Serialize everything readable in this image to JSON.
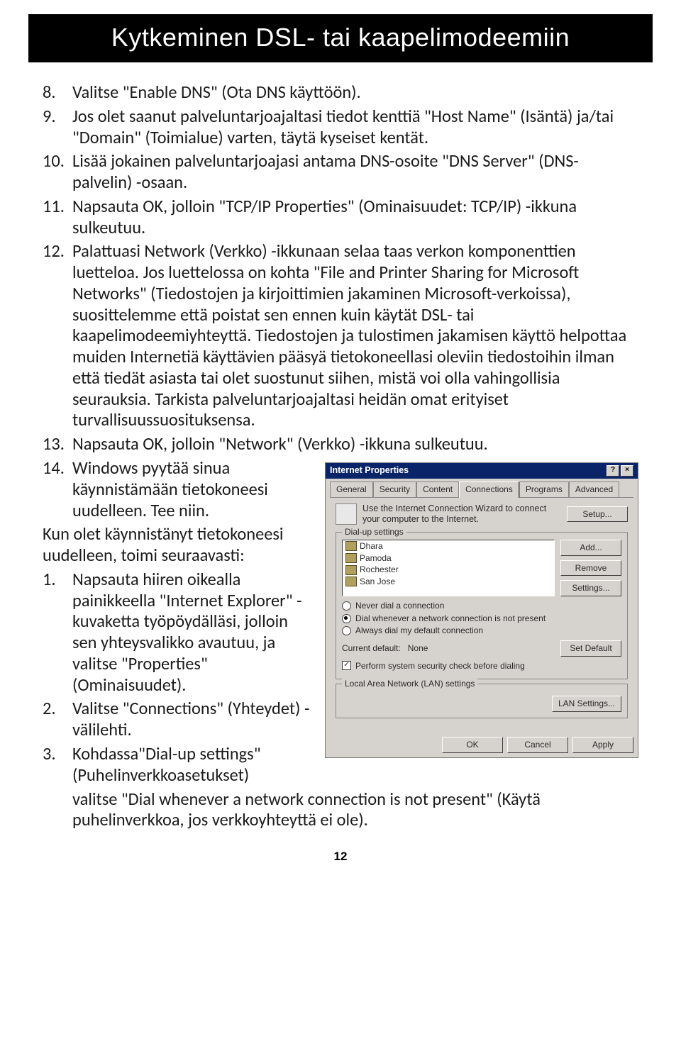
{
  "title_bar": "Kytkeminen DSL- tai kaapelimodeemiin",
  "list1": [
    {
      "n": "8.",
      "t": "Valitse \"Enable DNS\" (Ota DNS käyttöön)."
    },
    {
      "n": "9.",
      "t": "Jos olet saanut palveluntarjoajaltasi tiedot kenttiä \"Host Name\" (Isäntä) ja/tai \"Domain\" (Toimialue) varten, täytä kyseiset kentät."
    },
    {
      "n": "10.",
      "t": "Lisää jokainen palveluntarjoajasi antama DNS-osoite \"DNS Server\" (DNS-palvelin) -osaan."
    },
    {
      "n": "11.",
      "t": "Napsauta OK, jolloin \"TCP/IP Properties\" (Ominaisuudet: TCP/IP) -ikkuna sulkeutuu."
    },
    {
      "n": "12.",
      "t": "Palattuasi Network (Verkko) -ikkunaan selaa taas verkon komponenttien luetteloa. Jos luettelossa on kohta \"File and Printer Sharing for Microsoft Networks\" (Tiedostojen ja kirjoittimien jakaminen Microsoft-verkoissa), suosittelemme että poistat sen ennen kuin käytät DSL- tai kaapelimodeemiyhteyttä. Tiedostojen ja tulostimen jakamisen käyttö helpottaa muiden Internetiä käyttävien pääsyä tietokoneellasi oleviin tiedostoihin ilman että tiedät asiasta tai olet suostunut siihen, mistä voi olla vahingollisia seurauksia. Tarkista palveluntarjoajaltasi heidän omat erityiset turvallisuussuosituksensa."
    },
    {
      "n": "13.",
      "t": "Napsauta OK, jolloin \"Network\" (Verkko) -ikkuna sulkeutuu."
    }
  ],
  "item14": {
    "n": "14.",
    "t": "Windows pyytää sinua käynnistämään tietokoneesi uudelleen. Tee niin."
  },
  "after14": "Kun olet käynnistänyt tietokoneesi uudelleen, toimi seuraavasti:",
  "list2": [
    {
      "n": "1.",
      "t": "Napsauta hiiren oikealla painikkeella \"Internet Explorer\" -kuvaketta työpöydälläsi, jolloin sen yhteysvalikko avautuu, ja valitse \"Properties\" (Ominaisuudet)."
    },
    {
      "n": "2.",
      "t": "Valitse \"Connections\" (Yhteydet) -välilehti."
    }
  ],
  "item3": {
    "n": "3.",
    "t_a": "Kohdassa\"Dial-up settings\" (Puhelinverkkoasetukset)",
    "t_b": "valitse \"Dial whenever a network connection is not present\" (Käytä puhelinverkkoa, jos verkkoyhteyttä ei ole)."
  },
  "page_number": "12",
  "dialog": {
    "title": "Internet Properties",
    "help_btn": "?",
    "close_btn": "×",
    "tabs": [
      "General",
      "Security",
      "Content",
      "Connections",
      "Programs",
      "Advanced"
    ],
    "active_tab": "Connections",
    "info_text": "Use the Internet Connection Wizard to connect your computer to the Internet.",
    "setup_btn": "Setup...",
    "group_dialup": "Dial-up settings",
    "dial_items": [
      "Dhara",
      "Pamoda",
      "Rochester",
      "San Jose"
    ],
    "btn_add": "Add...",
    "btn_remove": "Remove",
    "btn_settings": "Settings...",
    "radios": [
      {
        "label": "Never dial a connection",
        "checked": false
      },
      {
        "label": "Dial whenever a network connection is not present",
        "checked": true
      },
      {
        "label": "Always dial my default connection",
        "checked": false
      }
    ],
    "current_default_label": "Current default:",
    "current_default_value": "None",
    "btn_setdefault": "Set Default",
    "check_security": "Perform system security check before dialing",
    "group_lan": "Local Area Network (LAN) settings",
    "btn_lan": "LAN Settings...",
    "btn_ok": "OK",
    "btn_cancel": "Cancel",
    "btn_apply": "Apply"
  }
}
